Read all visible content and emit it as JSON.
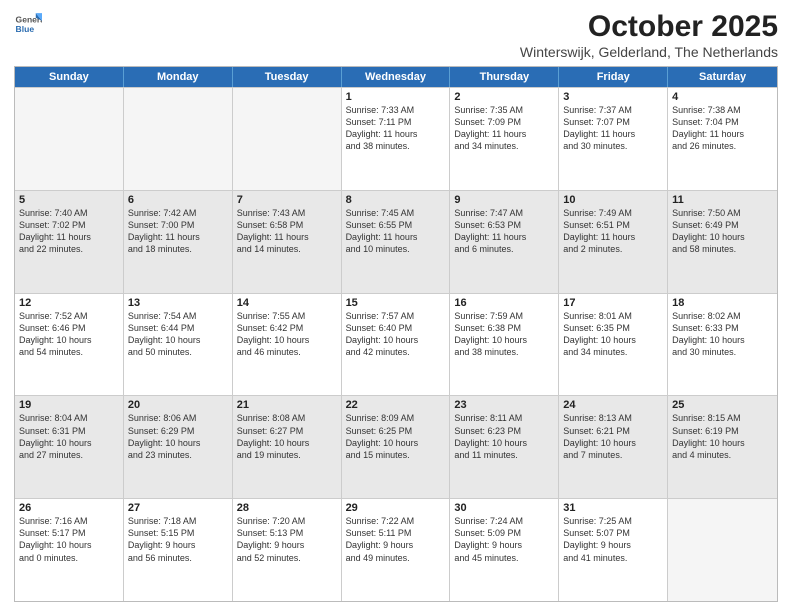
{
  "logo": {
    "general": "General",
    "blue": "Blue"
  },
  "title": "October 2025",
  "subtitle": "Winterswijk, Gelderland, The Netherlands",
  "days_of_week": [
    "Sunday",
    "Monday",
    "Tuesday",
    "Wednesday",
    "Thursday",
    "Friday",
    "Saturday"
  ],
  "weeks": [
    [
      {
        "day": "",
        "empty": true
      },
      {
        "day": "",
        "empty": true
      },
      {
        "day": "",
        "empty": true
      },
      {
        "day": "1",
        "lines": [
          "Sunrise: 7:33 AM",
          "Sunset: 7:11 PM",
          "Daylight: 11 hours",
          "and 38 minutes."
        ]
      },
      {
        "day": "2",
        "lines": [
          "Sunrise: 7:35 AM",
          "Sunset: 7:09 PM",
          "Daylight: 11 hours",
          "and 34 minutes."
        ]
      },
      {
        "day": "3",
        "lines": [
          "Sunrise: 7:37 AM",
          "Sunset: 7:07 PM",
          "Daylight: 11 hours",
          "and 30 minutes."
        ]
      },
      {
        "day": "4",
        "lines": [
          "Sunrise: 7:38 AM",
          "Sunset: 7:04 PM",
          "Daylight: 11 hours",
          "and 26 minutes."
        ]
      }
    ],
    [
      {
        "day": "5",
        "shaded": true,
        "lines": [
          "Sunrise: 7:40 AM",
          "Sunset: 7:02 PM",
          "Daylight: 11 hours",
          "and 22 minutes."
        ]
      },
      {
        "day": "6",
        "shaded": true,
        "lines": [
          "Sunrise: 7:42 AM",
          "Sunset: 7:00 PM",
          "Daylight: 11 hours",
          "and 18 minutes."
        ]
      },
      {
        "day": "7",
        "shaded": true,
        "lines": [
          "Sunrise: 7:43 AM",
          "Sunset: 6:58 PM",
          "Daylight: 11 hours",
          "and 14 minutes."
        ]
      },
      {
        "day": "8",
        "shaded": true,
        "lines": [
          "Sunrise: 7:45 AM",
          "Sunset: 6:55 PM",
          "Daylight: 11 hours",
          "and 10 minutes."
        ]
      },
      {
        "day": "9",
        "shaded": true,
        "lines": [
          "Sunrise: 7:47 AM",
          "Sunset: 6:53 PM",
          "Daylight: 11 hours",
          "and 6 minutes."
        ]
      },
      {
        "day": "10",
        "shaded": true,
        "lines": [
          "Sunrise: 7:49 AM",
          "Sunset: 6:51 PM",
          "Daylight: 11 hours",
          "and 2 minutes."
        ]
      },
      {
        "day": "11",
        "shaded": true,
        "lines": [
          "Sunrise: 7:50 AM",
          "Sunset: 6:49 PM",
          "Daylight: 10 hours",
          "and 58 minutes."
        ]
      }
    ],
    [
      {
        "day": "12",
        "lines": [
          "Sunrise: 7:52 AM",
          "Sunset: 6:46 PM",
          "Daylight: 10 hours",
          "and 54 minutes."
        ]
      },
      {
        "day": "13",
        "lines": [
          "Sunrise: 7:54 AM",
          "Sunset: 6:44 PM",
          "Daylight: 10 hours",
          "and 50 minutes."
        ]
      },
      {
        "day": "14",
        "lines": [
          "Sunrise: 7:55 AM",
          "Sunset: 6:42 PM",
          "Daylight: 10 hours",
          "and 46 minutes."
        ]
      },
      {
        "day": "15",
        "lines": [
          "Sunrise: 7:57 AM",
          "Sunset: 6:40 PM",
          "Daylight: 10 hours",
          "and 42 minutes."
        ]
      },
      {
        "day": "16",
        "lines": [
          "Sunrise: 7:59 AM",
          "Sunset: 6:38 PM",
          "Daylight: 10 hours",
          "and 38 minutes."
        ]
      },
      {
        "day": "17",
        "lines": [
          "Sunrise: 8:01 AM",
          "Sunset: 6:35 PM",
          "Daylight: 10 hours",
          "and 34 minutes."
        ]
      },
      {
        "day": "18",
        "lines": [
          "Sunrise: 8:02 AM",
          "Sunset: 6:33 PM",
          "Daylight: 10 hours",
          "and 30 minutes."
        ]
      }
    ],
    [
      {
        "day": "19",
        "shaded": true,
        "lines": [
          "Sunrise: 8:04 AM",
          "Sunset: 6:31 PM",
          "Daylight: 10 hours",
          "and 27 minutes."
        ]
      },
      {
        "day": "20",
        "shaded": true,
        "lines": [
          "Sunrise: 8:06 AM",
          "Sunset: 6:29 PM",
          "Daylight: 10 hours",
          "and 23 minutes."
        ]
      },
      {
        "day": "21",
        "shaded": true,
        "lines": [
          "Sunrise: 8:08 AM",
          "Sunset: 6:27 PM",
          "Daylight: 10 hours",
          "and 19 minutes."
        ]
      },
      {
        "day": "22",
        "shaded": true,
        "lines": [
          "Sunrise: 8:09 AM",
          "Sunset: 6:25 PM",
          "Daylight: 10 hours",
          "and 15 minutes."
        ]
      },
      {
        "day": "23",
        "shaded": true,
        "lines": [
          "Sunrise: 8:11 AM",
          "Sunset: 6:23 PM",
          "Daylight: 10 hours",
          "and 11 minutes."
        ]
      },
      {
        "day": "24",
        "shaded": true,
        "lines": [
          "Sunrise: 8:13 AM",
          "Sunset: 6:21 PM",
          "Daylight: 10 hours",
          "and 7 minutes."
        ]
      },
      {
        "day": "25",
        "shaded": true,
        "lines": [
          "Sunrise: 8:15 AM",
          "Sunset: 6:19 PM",
          "Daylight: 10 hours",
          "and 4 minutes."
        ]
      }
    ],
    [
      {
        "day": "26",
        "lines": [
          "Sunrise: 7:16 AM",
          "Sunset: 5:17 PM",
          "Daylight: 10 hours",
          "and 0 minutes."
        ]
      },
      {
        "day": "27",
        "lines": [
          "Sunrise: 7:18 AM",
          "Sunset: 5:15 PM",
          "Daylight: 9 hours",
          "and 56 minutes."
        ]
      },
      {
        "day": "28",
        "lines": [
          "Sunrise: 7:20 AM",
          "Sunset: 5:13 PM",
          "Daylight: 9 hours",
          "and 52 minutes."
        ]
      },
      {
        "day": "29",
        "lines": [
          "Sunrise: 7:22 AM",
          "Sunset: 5:11 PM",
          "Daylight: 9 hours",
          "and 49 minutes."
        ]
      },
      {
        "day": "30",
        "lines": [
          "Sunrise: 7:24 AM",
          "Sunset: 5:09 PM",
          "Daylight: 9 hours",
          "and 45 minutes."
        ]
      },
      {
        "day": "31",
        "lines": [
          "Sunrise: 7:25 AM",
          "Sunset: 5:07 PM",
          "Daylight: 9 hours",
          "and 41 minutes."
        ]
      },
      {
        "day": "",
        "empty": true
      }
    ]
  ]
}
